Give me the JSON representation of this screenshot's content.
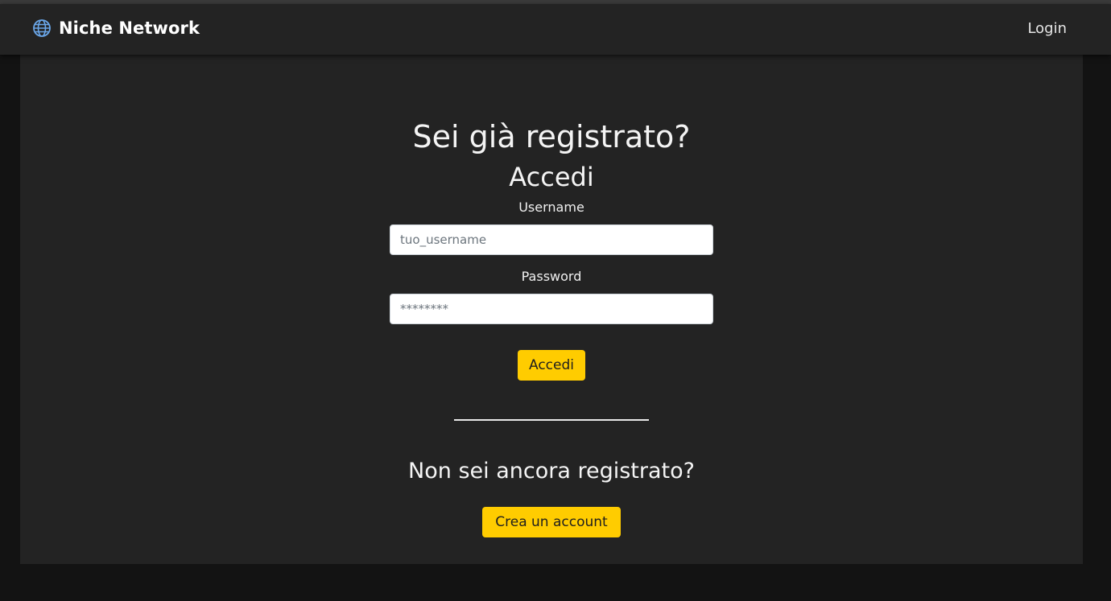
{
  "navbar": {
    "brand_name": "Niche Network",
    "brand_icon": "globe-icon",
    "login_link": "Login"
  },
  "login_section": {
    "title": "Sei già registrato?",
    "subtitle": "Accedi",
    "username_label": "Username",
    "username_placeholder": "tuo_username",
    "password_label": "Password",
    "password_placeholder": "********",
    "submit_label": "Accedi"
  },
  "register_section": {
    "title": "Non sei ancora registrato?",
    "create_account_label": "Crea un account"
  },
  "colors": {
    "accent": "#ffcc00",
    "panel_bg": "#232323",
    "page_bg": "#131313",
    "brand_icon": "#6aa6e8"
  }
}
